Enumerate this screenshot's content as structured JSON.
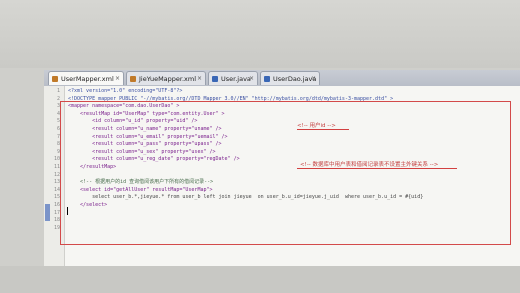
{
  "tabs": [
    {
      "label": "UserMapper.xml",
      "active": true,
      "icon": "xml-file-icon"
    },
    {
      "label": "JieYueMapper.xml",
      "active": false,
      "icon": "xml-file-icon"
    },
    {
      "label": "User.java",
      "active": false,
      "icon": "java-file-icon"
    },
    {
      "label": "UserDao.java",
      "active": false,
      "icon": "java-file-icon"
    }
  ],
  "tab_close_glyph": "×",
  "line_numbers": [
    "1",
    "2",
    "3",
    "4",
    "5",
    "6",
    "7",
    "8",
    "9",
    "10",
    "11",
    "12",
    "13",
    "14",
    "15",
    "16",
    "17",
    "18",
    "19"
  ],
  "lines": [
    "<?xml version=\"1.0\" encoding=\"UTF-8\"?>",
    "<!DOCTYPE mapper PUBLIC \"-//mybatis.org//DTD Mapper 3.0//EN\" \"http://mybatis.org/dtd/mybatis-3-mapper.dtd\" >",
    "<mapper namespace=\"com.dao.UserDao\" >",
    "    <resultMap id=\"UserMap\" type=\"com.entity.User\" >",
    "        <id column=\"u_id\" property=\"uid\" />",
    "        <result column=\"u_name\" property=\"uname\" />",
    "        <result column=\"u_email\" property=\"uemail\" />",
    "        <result column=\"u_pass\" property=\"upass\" />",
    "        <result column=\"u_sex\" property=\"usex\" />",
    "        <result column=\"u_reg_date\" property=\"regDate\" />",
    "    </resultMap>",
    "",
    "    <!-- 根据用户的id 查询借阅该用户下所有的借阅记录-->",
    "    <select id=\"getAllUser\" resultMap=\"UserMap\">",
    "        select user_b.*,jieyue.* from user_b left join jieyue  on user_b.u_id=jieyue.j_uid  where user_b.u_id = #{uid}",
    "    </select>",
    "",
    "",
    ""
  ],
  "annotations": {
    "user_id": "<!-- 用户id -->",
    "relation": "<!-- 数据库中用户表和借阅记录表不设置主外键关系 -->"
  }
}
